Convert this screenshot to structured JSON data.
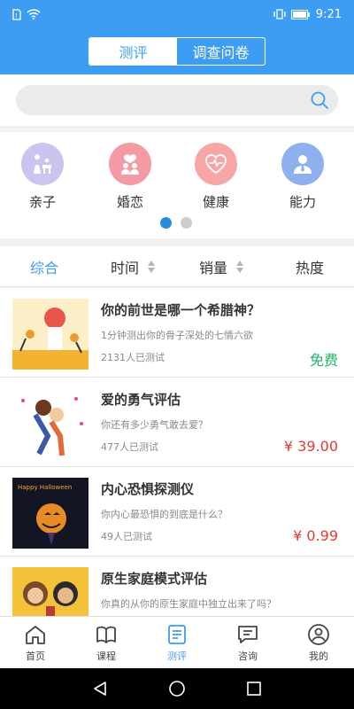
{
  "status": {
    "time": "9:21"
  },
  "header": {
    "tabs": [
      {
        "label": "测评"
      },
      {
        "label": "调查问卷"
      }
    ]
  },
  "search": {
    "placeholder": ""
  },
  "categories": [
    {
      "label": "亲子",
      "color": "#c9c5ee"
    },
    {
      "label": "婚恋",
      "color": "#f49aa4"
    },
    {
      "label": "健康",
      "color": "#f7a6a6"
    },
    {
      "label": "能力",
      "color": "#8fb0ee"
    }
  ],
  "sort": [
    {
      "label": "综合"
    },
    {
      "label": "时间"
    },
    {
      "label": "销量"
    },
    {
      "label": "热度"
    }
  ],
  "items": [
    {
      "title": "你的前世是哪一个希腊神？",
      "desc": "1分钟测出你的骨子深处的七情六欲",
      "count": "2131人已测试",
      "price": "免费"
    },
    {
      "title": "爱的勇气评估",
      "desc": "你还有多少勇气敢去爱？",
      "count": "477人已测试",
      "price": "¥ 39.00"
    },
    {
      "title": "内心恐惧探测仪",
      "desc": "你内心最恐惧的到底是什么？",
      "count": "49人已测试",
      "price": "¥ 0.99",
      "thumb_text": "Happy Halloween"
    },
    {
      "title": "原生家庭模式评估",
      "desc": "你真的从你的原生家庭中独立出来了吗？",
      "count": "",
      "price": ""
    }
  ],
  "nav": [
    {
      "label": "首页"
    },
    {
      "label": "课程"
    },
    {
      "label": "测评"
    },
    {
      "label": "咨询"
    },
    {
      "label": "我的"
    }
  ],
  "colors": {
    "primary": "#3d9df3",
    "price": "#e53935",
    "free": "#1bb569"
  }
}
